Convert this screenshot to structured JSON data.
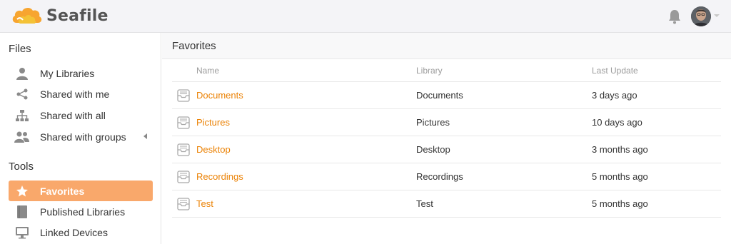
{
  "app": {
    "name": "Seafile"
  },
  "sidebar": {
    "files_heading": "Files",
    "tools_heading": "Tools",
    "items": [
      {
        "label": "My Libraries",
        "icon": "user-icon"
      },
      {
        "label": "Shared with me",
        "icon": "share-icon"
      },
      {
        "label": "Shared with all",
        "icon": "org-tree-icon"
      },
      {
        "label": "Shared with groups",
        "icon": "group-icon"
      },
      {
        "label": "Favorites",
        "icon": "star-icon",
        "active": true
      },
      {
        "label": "Published Libraries",
        "icon": "book-icon"
      },
      {
        "label": "Linked Devices",
        "icon": "monitor-icon"
      }
    ]
  },
  "main": {
    "title": "Favorites",
    "columns": {
      "name": "Name",
      "library": "Library",
      "last_update": "Last Update"
    },
    "rows": [
      {
        "name": "Documents",
        "library": "Documents",
        "last_update": "3 days ago"
      },
      {
        "name": "Pictures",
        "library": "Pictures",
        "last_update": "10 days ago"
      },
      {
        "name": "Desktop",
        "library": "Desktop",
        "last_update": "3 months ago"
      },
      {
        "name": "Recordings",
        "library": "Recordings",
        "last_update": "5 months ago"
      },
      {
        "name": "Test",
        "library": "Test",
        "last_update": "5 months ago"
      }
    ]
  },
  "colors": {
    "accent": "#eb8205",
    "active_bg": "#f9a86b",
    "header_bg": "#f4f4f7"
  }
}
